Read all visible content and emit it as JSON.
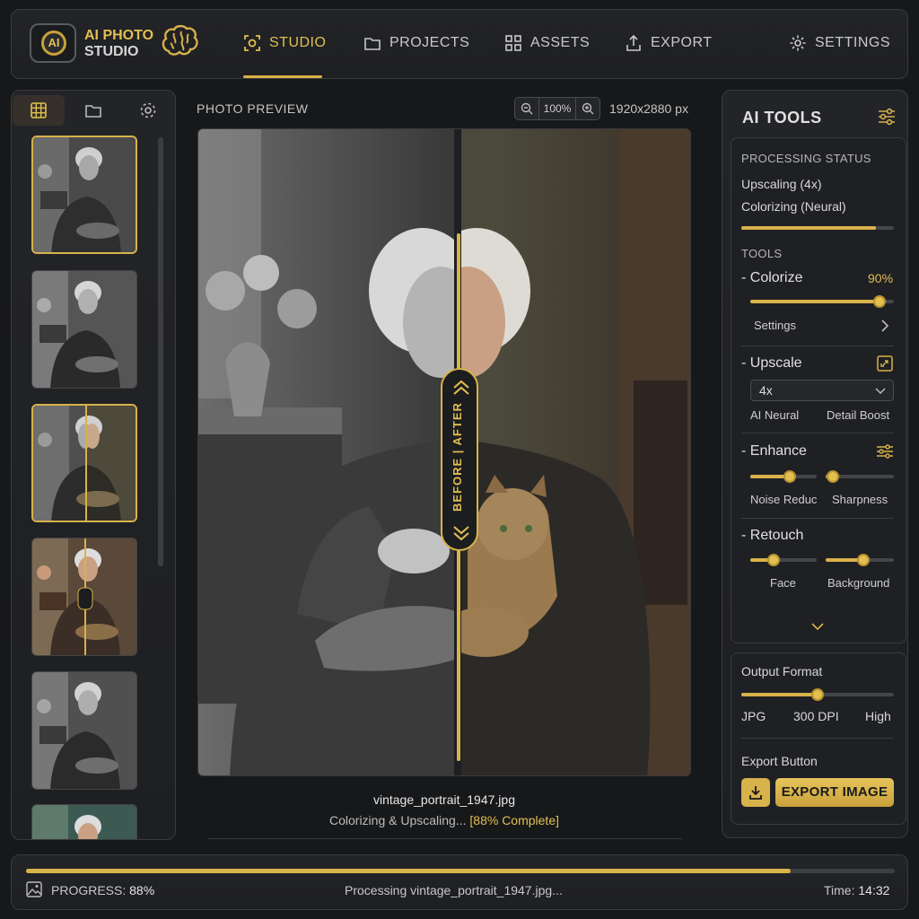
{
  "header": {
    "logo_badge": "AI",
    "app_name_line1": "AI PHOTO",
    "app_name_line2": "STUDIO",
    "nav": [
      {
        "label": "STUDIO",
        "icon": "focus-frame-icon",
        "active": true
      },
      {
        "label": "PROJECTS",
        "icon": "folder-icon"
      },
      {
        "label": "ASSETS",
        "icon": "grid-icon"
      },
      {
        "label": "EXPORT",
        "icon": "upload-icon"
      },
      {
        "label": "SETTINGS",
        "icon": "gear-icon"
      }
    ]
  },
  "sidebar": {
    "tabs": [
      "grid-icon",
      "folder-icon",
      "gear-icon"
    ],
    "thumbnails": 6
  },
  "preview": {
    "title": "PHOTO PREVIEW",
    "zoom": "100%",
    "resolution": "1920x2880 px",
    "compare_label": "BEFORE | AFTER",
    "filename": "vintage_portrait_1947.jpg",
    "status_prefix": "Colorizing & Upscaling...",
    "status_progress": "[88% Complete]"
  },
  "ai_tools": {
    "title": "AI TOOLS",
    "processing_status_heading": "PROCESSING STATUS",
    "processing_items": [
      "Upscaling (4x)",
      "Colorizing (Neural)"
    ],
    "processing_progress": 0.88,
    "tools_heading": "TOOLS",
    "colorize": {
      "label": "- Colorize",
      "value": "90%",
      "level": 0.9,
      "settings_label": "Settings"
    },
    "upscale": {
      "label": "- Upscale",
      "selected": "4x",
      "option_a": "AI Neural",
      "option_b": "Detail Boost"
    },
    "enhance": {
      "label": "- Enhance",
      "slider_a": "Noise Reduc",
      "slider_b": "Sharpness",
      "level_a": 0.6,
      "level_b": 0.1
    },
    "retouch": {
      "label": "- Retouch",
      "slider_a": "Face",
      "slider_b": "Background",
      "level_a": 0.35,
      "level_b": 0.55
    }
  },
  "output": {
    "heading": "Output Format",
    "level": 0.5,
    "format": "JPG",
    "dpi": "300 DPI",
    "quality": "High",
    "export_heading": "Export Button",
    "export_label": "EXPORT IMAGE"
  },
  "bottom": {
    "progress_label": "PROGRESS:",
    "progress_value": "88%",
    "progress": 0.88,
    "processing_prefix": "Processing",
    "processing_file": "vintage_portrait_1947.jpg...",
    "time_label": "Time:",
    "time_value": "14:32"
  },
  "colors": {
    "accent": "#d8b24a",
    "background": "#17181a",
    "panel": "#232427"
  }
}
